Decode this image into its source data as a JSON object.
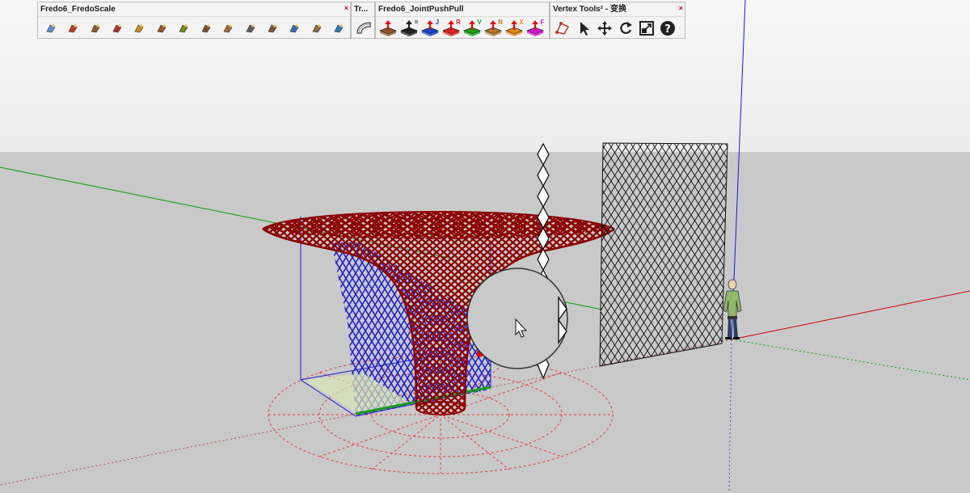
{
  "toolbars": {
    "fredoscale": {
      "title": "Fredo6_FredoScale"
    },
    "tr": {
      "title": "Tr..."
    },
    "jointpushpull": {
      "title": "Fredo6_JointPushPull",
      "letters": [
        "",
        "=",
        "J",
        "R",
        "V",
        "N",
        "X",
        "F"
      ]
    },
    "vertex": {
      "title": "Vertex Tools² - 变换"
    }
  },
  "colors": {
    "sky": "#f5f5f5",
    "ground": "#c9c9c9",
    "model": "#8b0000",
    "selection": "#1a1acc",
    "axis_red": "#cc0000",
    "axis_green": "#009900",
    "axis_blue": "#0000dd"
  },
  "icons": {
    "fredoscale": [
      "scale-icon",
      "box-scale-icon",
      "tapering-icon",
      "plane-shear-icon",
      "stretch-icon",
      "twist-icon",
      "bend-icon",
      "rotate-icon",
      "radial-bend-icon",
      "untaper-icon",
      "box-icon",
      "rotate-about-icon",
      "scale-plane-icon",
      "help-icon"
    ],
    "jointpushpull": [
      "joint-pushpull-icon",
      "vector-pushpull-icon",
      "joint-pushpull-j-icon",
      "round-pushpull-icon",
      "vector-pushpull-v-icon",
      "normal-pushpull-icon",
      "extrude-pushpull-icon",
      "follow-pushpull-icon"
    ],
    "vertex": [
      "vertex-select-icon",
      "arrow-cursor-icon",
      "move-icon",
      "rotate-icon",
      "scale-icon",
      "help-icon"
    ]
  }
}
